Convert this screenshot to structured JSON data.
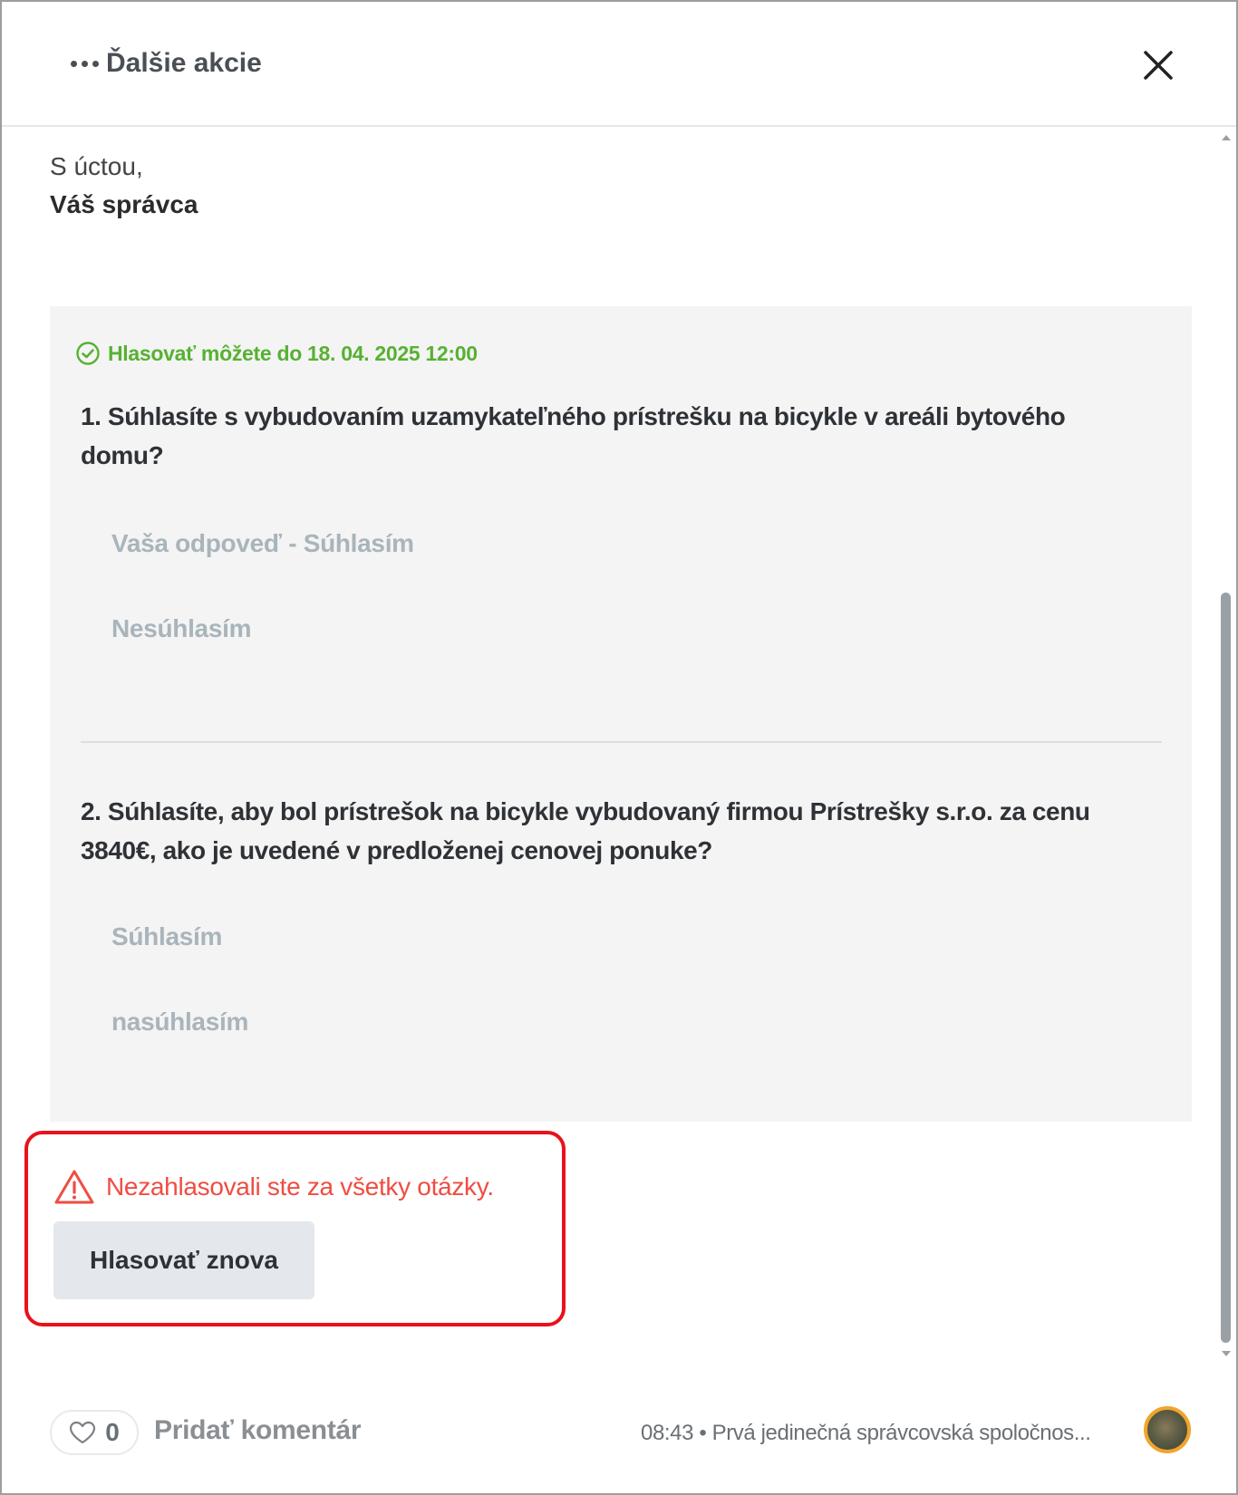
{
  "header": {
    "more_actions_label": "Ďalšie akcie"
  },
  "message": {
    "greeting": "S úctou,",
    "signature": "Váš správca"
  },
  "poll": {
    "deadline": "Hlasovať môžete do 18. 04. 2025 12:00",
    "questions": [
      {
        "text": "1. Súhlasíte s vybudovaním uzamykateľného prístrešku na bicykle v areáli bytového domu?",
        "options": [
          "Vaša odpoveď - Súhlasím",
          "Nesúhlasím"
        ]
      },
      {
        "text": "2. Súhlasíte, aby bol prístrešok na bicykle vybudovaný firmou Prístrešky s.r.o. za cenu 3840€, ako je uvedené v predloženej cenovej ponuke?",
        "options": [
          "Súhlasím",
          "nasúhlasím"
        ]
      }
    ]
  },
  "alert": {
    "warning_text": "Nezahlasovali ste za všetky otázky.",
    "vote_again_label": "Hlasovať znova"
  },
  "footer": {
    "like_count": "0",
    "add_comment_label": "Pridať komentár",
    "meta": "08:43 • Prvá jedinečná správcovská spoločnos..."
  },
  "colors": {
    "deadline_green": "#57b132",
    "warning_red": "#ef4d42",
    "alert_border_red": "#e8121c",
    "avatar_ring": "#f0a52b"
  }
}
